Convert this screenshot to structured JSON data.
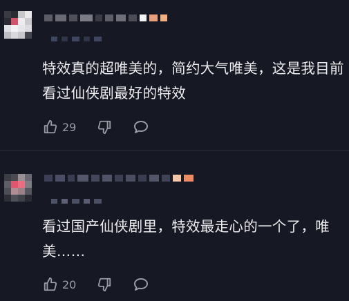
{
  "comments": [
    {
      "text": "特效真的超唯美的，简约大气唯美，这是我目前看过仙侠剧最好的特效",
      "likes": "29"
    },
    {
      "text": "看过国产仙侠剧里，特效最走心的一个了，唯美……",
      "likes": "20"
    }
  ],
  "icons": {
    "like": "thumbs-up-icon",
    "dislike": "thumbs-down-icon",
    "reply": "speech-bubble-icon"
  },
  "colors": {
    "background": "#161823",
    "text": "#ececee",
    "muted": "#9a9ca5"
  }
}
